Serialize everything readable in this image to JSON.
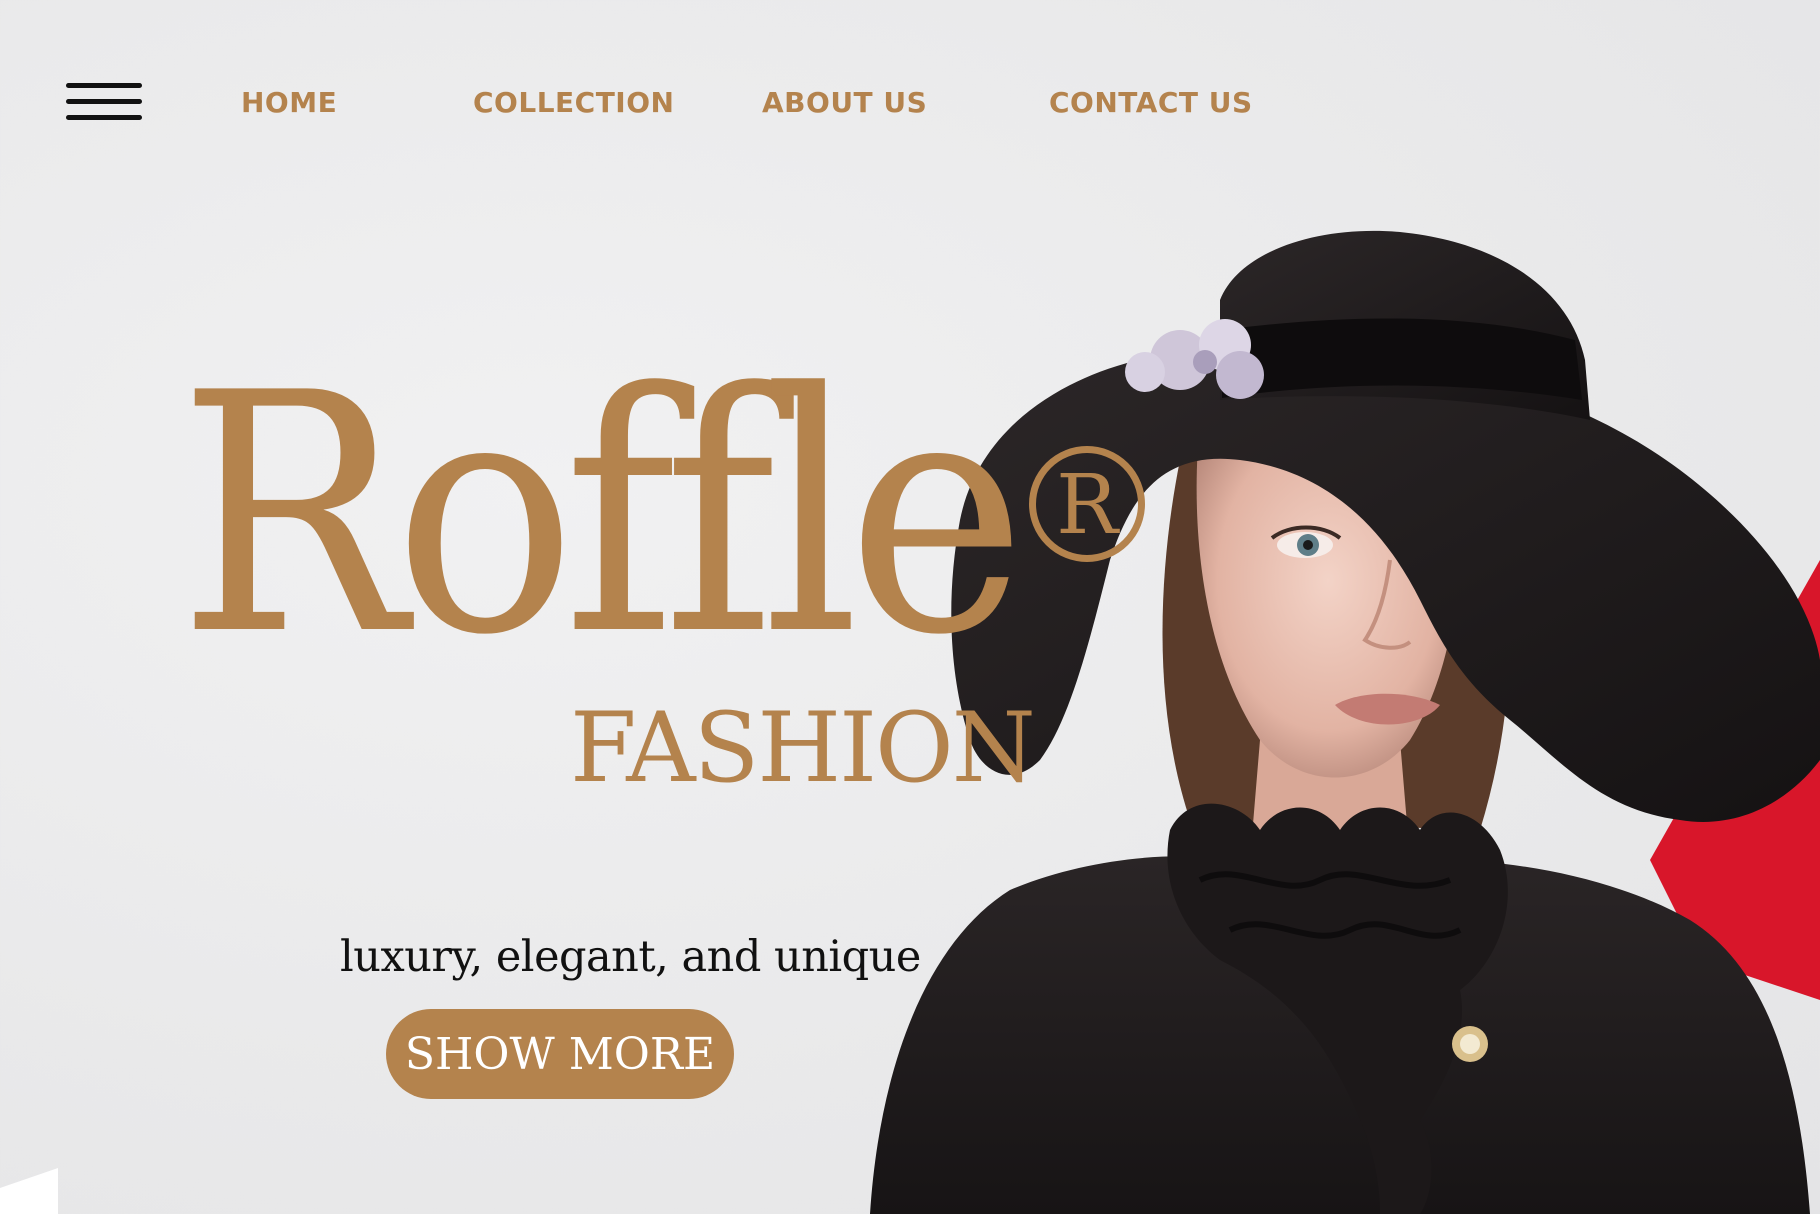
{
  "nav": {
    "menu_icon": "hamburger-menu-icon",
    "links": [
      "HOME",
      "COLLECTION",
      "ABOUT US",
      "CONTACT US"
    ]
  },
  "hero": {
    "brand": "Roffle",
    "registered_mark": "R",
    "subtitle": "FASHION",
    "tagline": "luxury, elegant, and unique",
    "cta_label": "SHOW MORE"
  },
  "colors": {
    "accent": "#b4834d",
    "background": "#ececed",
    "text_dark": "#111111",
    "accent_red": "#d8162a"
  }
}
